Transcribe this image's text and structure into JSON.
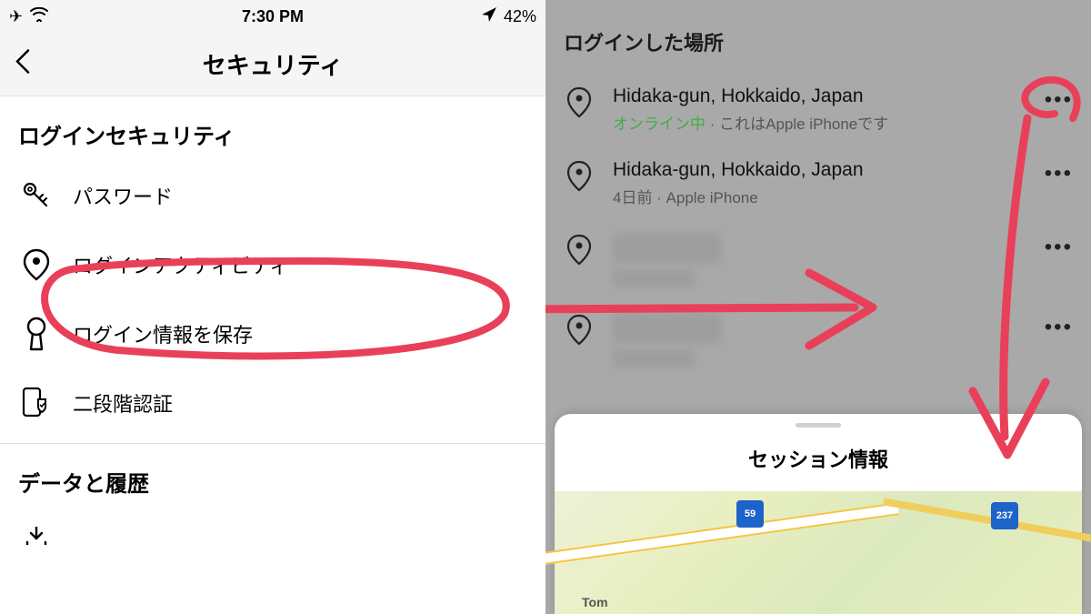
{
  "status": {
    "time": "7:30 PM",
    "battery": "42%"
  },
  "nav": {
    "title": "セキュリティ"
  },
  "security": {
    "section_login": "ログインセキュリティ",
    "password": "パスワード",
    "login_activity": "ログインアクティビティ",
    "save_login": "ログイン情報を保存",
    "two_factor": "二段階認証",
    "section_data": "データと履歴"
  },
  "right": {
    "header": "ログインした場所",
    "sessions": [
      {
        "location": "Hidaka-gun, Hokkaido, Japan",
        "status_online": "オンライン中",
        "status_device": " · これはApple iPhoneです"
      },
      {
        "location": "Hidaka-gun, Hokkaido, Japan",
        "sub": "4日前 · Apple iPhone"
      }
    ],
    "sheet_title": "セッション情報",
    "map": {
      "shield1": "59",
      "shield2": "237",
      "city": "Tom"
    }
  }
}
